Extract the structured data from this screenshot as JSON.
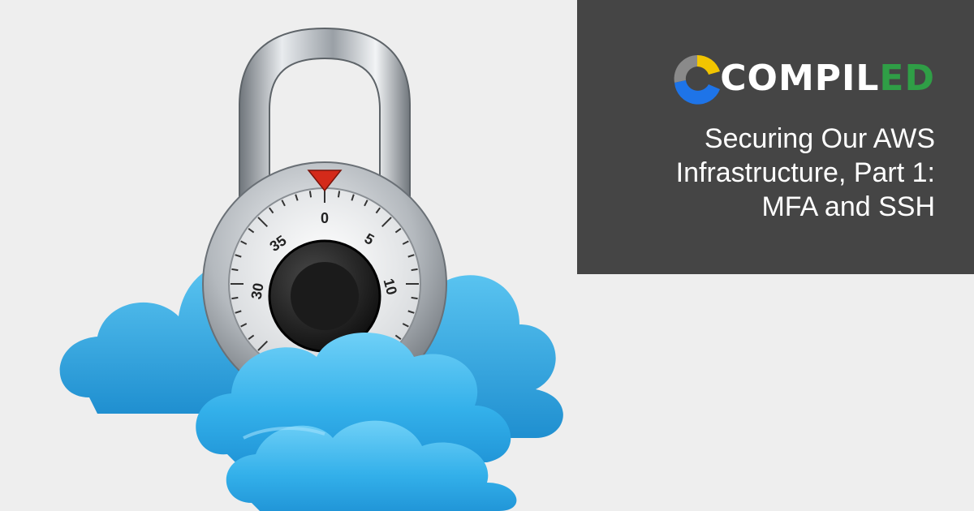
{
  "logo": {
    "text_main": "COMPIL",
    "text_accent": "ED",
    "colors": {
      "yellow": "#f2c500",
      "blue": "#1e74e8",
      "grey": "#8a8a8a",
      "green": "#2f9e46"
    }
  },
  "title": {
    "lines": [
      "Securing Our AWS",
      "Infrastructure, Part 1:",
      "MFA and SSH"
    ]
  },
  "illustration": {
    "icon": "padlock-on-clouds",
    "dial_numbers": [
      "0",
      "5",
      "10",
      "30",
      "35"
    ],
    "colors": {
      "cloud": "#3db6ee",
      "lock_body": "#b9bec3",
      "indicator": "#d42a1a",
      "knob": "#1a1a1a"
    }
  }
}
